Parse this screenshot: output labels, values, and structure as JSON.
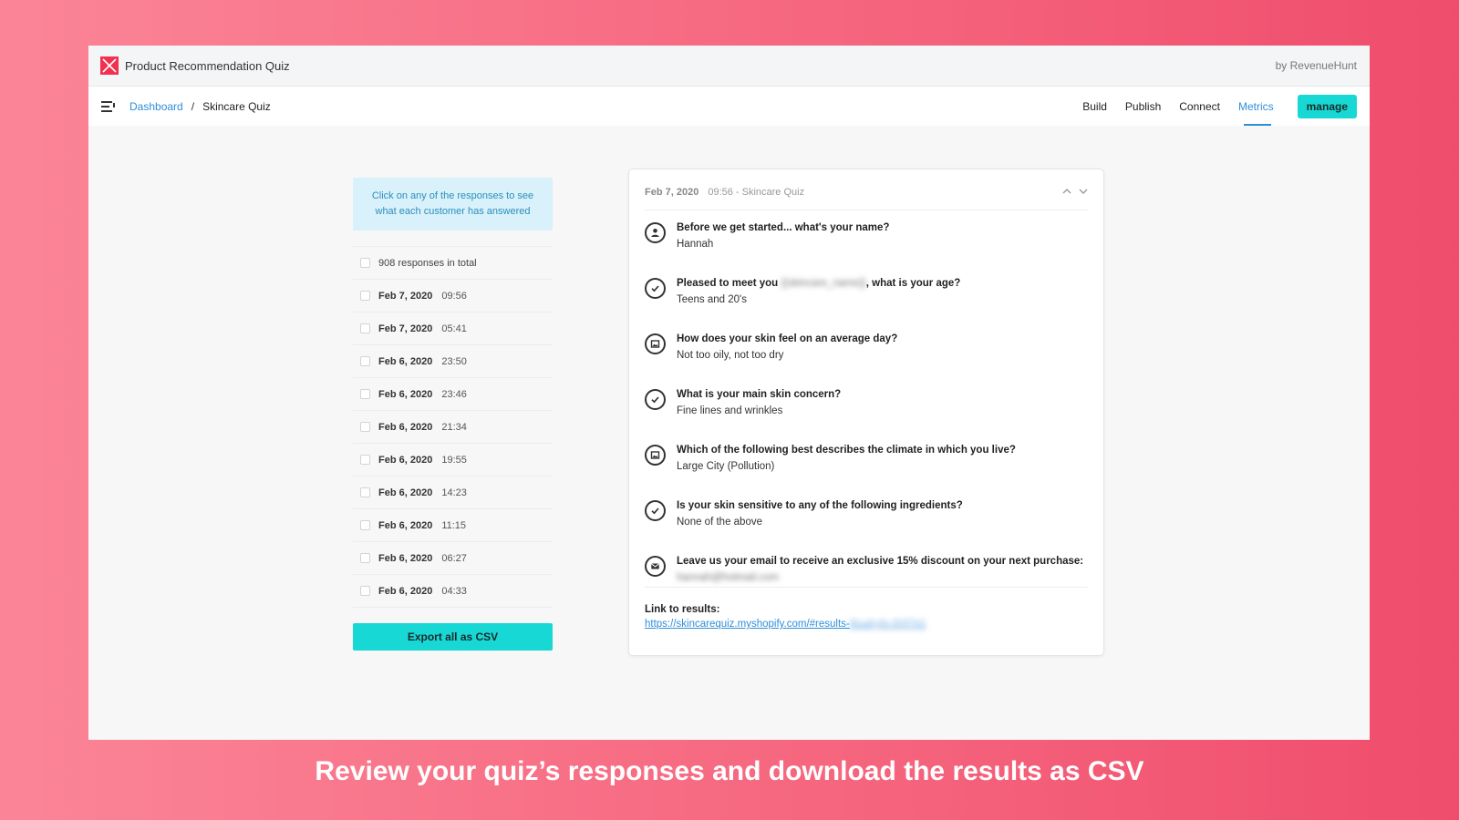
{
  "app": {
    "title": "Product Recommendation Quiz",
    "byline": "by RevenueHunt"
  },
  "breadcrumb": {
    "root": "Dashboard",
    "separator": "/",
    "current": "Skincare Quiz"
  },
  "nav": {
    "items": [
      {
        "label": "Build",
        "active": false
      },
      {
        "label": "Publish",
        "active": false
      },
      {
        "label": "Connect",
        "active": false
      },
      {
        "label": "Metrics",
        "active": true
      }
    ],
    "manage_label": "manage"
  },
  "sidebar": {
    "hint": "Click on any of the responses to see what each customer has answered",
    "total": "908 responses in total",
    "responses": [
      {
        "date": "Feb 7, 2020",
        "time": "09:56"
      },
      {
        "date": "Feb 7, 2020",
        "time": "05:41"
      },
      {
        "date": "Feb 6, 2020",
        "time": "23:50"
      },
      {
        "date": "Feb 6, 2020",
        "time": "23:46"
      },
      {
        "date": "Feb 6, 2020",
        "time": "21:34"
      },
      {
        "date": "Feb 6, 2020",
        "time": "19:55"
      },
      {
        "date": "Feb 6, 2020",
        "time": "14:23"
      },
      {
        "date": "Feb 6, 2020",
        "time": "11:15"
      },
      {
        "date": "Feb 6, 2020",
        "time": "06:27"
      },
      {
        "date": "Feb 6, 2020",
        "time": "04:33"
      }
    ],
    "export_label": "Export all as CSV"
  },
  "detail": {
    "date": "Feb 7, 2020",
    "meta": "09:56 - Skincare Quiz",
    "answers": [
      {
        "icon": "user-icon",
        "question": "Before we get started... what's your name?",
        "answer": "Hannah"
      },
      {
        "icon": "check-icon",
        "question_pre": "Pleased to meet you",
        "question_blur": "{{skincare_name}}",
        "question_post": ", what is your age?",
        "answer": "Teens and 20's"
      },
      {
        "icon": "image-icon",
        "question": "How does your skin feel on an average day?",
        "answer": "Not too oily, not too dry"
      },
      {
        "icon": "check-icon",
        "question": "What is your main skin concern?",
        "answer": "Fine lines and wrinkles"
      },
      {
        "icon": "image-icon",
        "question": "Which of the following best describes the climate in which you live?",
        "answer": "Large City (Pollution)"
      },
      {
        "icon": "check-icon",
        "question": "Is your skin sensitive to any of the following ingredients?",
        "answer": "None of the above"
      },
      {
        "icon": "email-icon",
        "question": "Leave us your email to receive an exclusive 15% discount on your next purchase:",
        "answer": "hannah@hotmail.com"
      }
    ],
    "link_label": "Link to results:",
    "link_url": "https://skincarequiz.myshopify.com/#results-",
    "link_blur": "l8uahyfe-8XFhG"
  },
  "caption": "Review your quiz’s responses and download the results as CSV",
  "colors": {
    "accent": "#17d8d4",
    "link": "#2f8ed9",
    "brand": "#f2304f"
  }
}
